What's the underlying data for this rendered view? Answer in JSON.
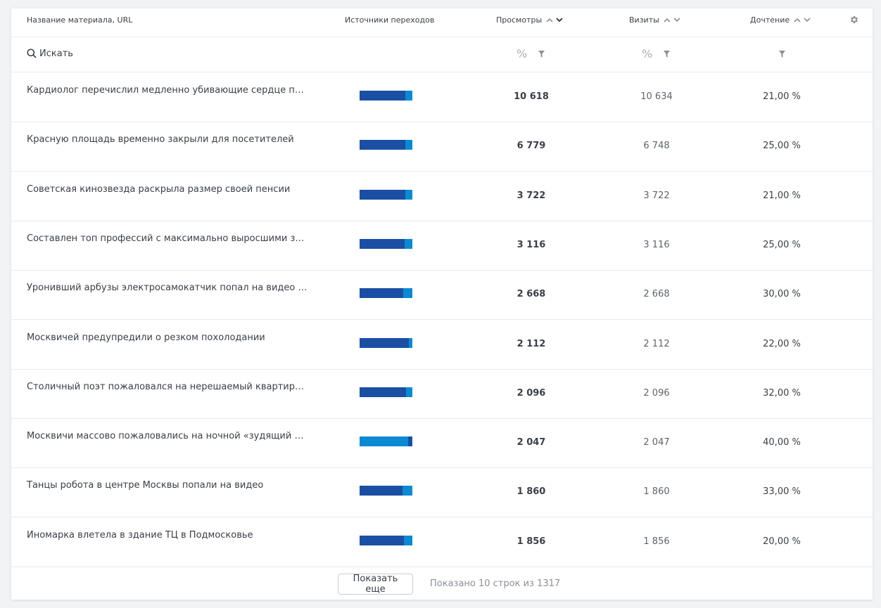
{
  "header": {
    "title_col": "Название материала, URL",
    "sources_col": "Источники переходов",
    "views_col": "Просмотры",
    "visits_col": "Визиты",
    "read_col": "Дочтение"
  },
  "search": {
    "placeholder": "Искать"
  },
  "filters": {
    "views_unit": "%",
    "visits_unit": "%"
  },
  "colors": {
    "bar_dark": "#1a4fa3",
    "bar_light": "#0a8ad2"
  },
  "rows": [
    {
      "title": "Кардиолог перечислил медленно убивающие сердце пр...",
      "views": "10 618",
      "visits": "10 634",
      "read": "21,00 %",
      "sources": [
        {
          "color": "#1a4fa3",
          "share": 0.86
        },
        {
          "color": "#0a8ad2",
          "share": 0.14
        }
      ]
    },
    {
      "title": "Красную площадь временно закрыли для посетителей",
      "views": "6 779",
      "visits": "6 748",
      "read": "25,00 %",
      "sources": [
        {
          "color": "#1a4fa3",
          "share": 0.87
        },
        {
          "color": "#0a8ad2",
          "share": 0.13
        }
      ]
    },
    {
      "title": "Советская кинозвезда раскрыла размер своей пенсии",
      "views": "3 722",
      "visits": "3 722",
      "read": "21,00 %",
      "sources": [
        {
          "color": "#1a4fa3",
          "share": 0.87
        },
        {
          "color": "#0a8ad2",
          "share": 0.13
        }
      ]
    },
    {
      "title": "Составлен топ профессий с максимально выросшими за...",
      "views": "3 116",
      "visits": "3 116",
      "read": "25,00 %",
      "sources": [
        {
          "color": "#1a4fa3",
          "share": 0.85
        },
        {
          "color": "#0a8ad2",
          "share": 0.15
        }
      ]
    },
    {
      "title": "Уронивший арбузы электросамокатчик попал на видео и...",
      "views": "2 668",
      "visits": "2 668",
      "read": "30,00 %",
      "sources": [
        {
          "color": "#1a4fa3",
          "share": 0.82
        },
        {
          "color": "#0a8ad2",
          "share": 0.18
        }
      ]
    },
    {
      "title": "Москвичей предупредили о резком похолодании",
      "views": "2 112",
      "visits": "2 112",
      "read": "22,00 %",
      "sources": [
        {
          "color": "#1a4fa3",
          "share": 0.93
        },
        {
          "color": "#0a8ad2",
          "share": 0.07
        }
      ]
    },
    {
      "title": "Столичный поэт пожаловался на нерешаемый квартирны...",
      "views": "2 096",
      "visits": "2 096",
      "read": "32,00 %",
      "sources": [
        {
          "color": "#1a4fa3",
          "share": 0.88
        },
        {
          "color": "#0a8ad2",
          "share": 0.12
        }
      ]
    },
    {
      "title": "Москвичи массово пожаловались на ночной «зудящий гу...",
      "views": "2 047",
      "visits": "2 047",
      "read": "40,00 %",
      "sources": [
        {
          "color": "#0a8ad2",
          "share": 0.92
        },
        {
          "color": "#1a4fa3",
          "share": 0.08
        }
      ]
    },
    {
      "title": "Танцы робота в центре Москвы попали на видео",
      "views": "1 860",
      "visits": "1 860",
      "read": "33,00 %",
      "sources": [
        {
          "color": "#1a4fa3",
          "share": 0.81
        },
        {
          "color": "#0a8ad2",
          "share": 0.19
        }
      ]
    },
    {
      "title": "Иномарка влетела в здание ТЦ в Подмосковье",
      "views": "1 856",
      "visits": "1 856",
      "read": "20,00 %",
      "sources": [
        {
          "color": "#1a4fa3",
          "share": 0.84
        },
        {
          "color": "#0a8ad2",
          "share": 0.16
        }
      ]
    }
  ],
  "footer": {
    "more_label": "Показать еще",
    "shown_text": "Показано 10 строк из 1317"
  }
}
